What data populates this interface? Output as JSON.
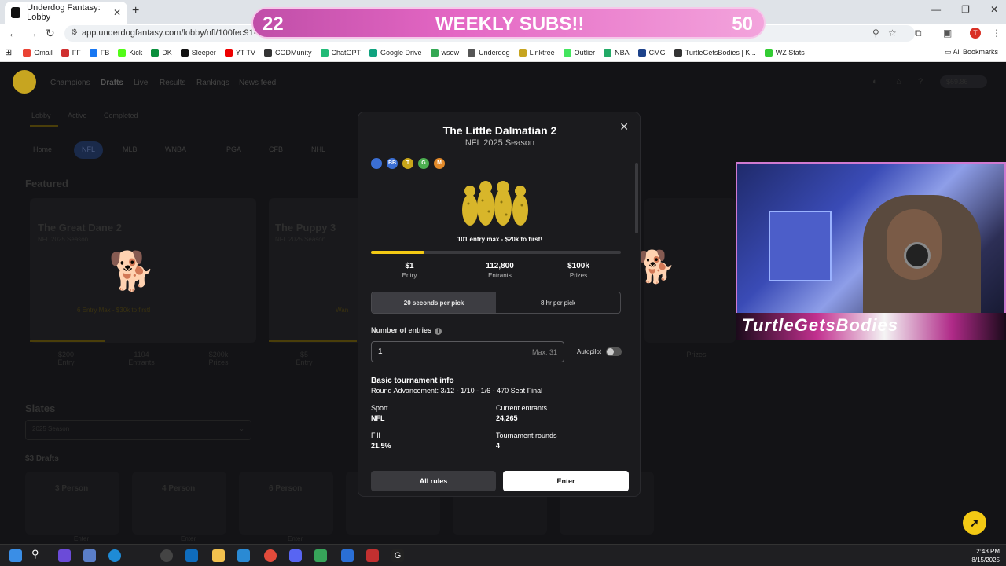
{
  "browser": {
    "tab_title": "Underdog Fantasy: Lobby",
    "url": "app.underdogfantasy.com/lobby/nfl/100fec91-ff4f-43"
  },
  "bookmarks": [
    "Gmail",
    "FF",
    "FB",
    "Kick",
    "DK",
    "Sleeper",
    "YT TV",
    "CODMunity",
    "ChatGPT",
    "Google Drive",
    "wsow",
    "Underdog",
    "Linktree",
    "Outlier",
    "NBA",
    "CMG",
    "TurtleGetsBodies | K...",
    "WZ Stats"
  ],
  "all_bookmarks": "All Bookmarks",
  "page": {
    "nav": [
      "Champions",
      "Drafts",
      "Live",
      "Results",
      "Rankings",
      "News feed"
    ],
    "balance": "$69.86",
    "subnav": [
      "Lobby",
      "Active",
      "Completed"
    ],
    "sports": [
      "Home",
      "NFL",
      "MLB",
      "WNBA",
      "PGA",
      "CFB",
      "NHL"
    ],
    "featured_label": "Featured",
    "cards": [
      {
        "title": "The Great Dane 2",
        "season": "NFL 2025 Season",
        "tag": "6 Entry Max - $30k to first!",
        "stats": [
          "$200",
          "1104",
          "$200k"
        ]
      },
      {
        "title": "The Puppy 3",
        "season": "NFL 2025 Season",
        "tag": "Wan",
        "stats": [
          "$5",
          "",
          ""
        ]
      }
    ],
    "stat_keys": [
      "Entry",
      "Entrants",
      "Prizes"
    ],
    "slates_label": "Slates",
    "slate_select": "2025 Season",
    "drafts_label": "$3 Drafts",
    "smalls": [
      "3 Person",
      "4 Person",
      "6 Person"
    ],
    "enter": "Enter"
  },
  "overlay": {
    "subs_left": "22",
    "subs_label": "WEEKLY SUBS!!",
    "subs_right": "50",
    "cam_name": "TurtleGetsBodies"
  },
  "modal": {
    "title": "The Little Dalmatian 2",
    "subtitle": "NFL 2025 Season",
    "badges": [
      {
        "label": "",
        "color": "#3b6fd4"
      },
      {
        "label": "BB",
        "color": "#3b6fd4"
      },
      {
        "label": "T",
        "color": "#c9a61a"
      },
      {
        "label": "G",
        "color": "#4caf50"
      },
      {
        "label": "M",
        "color": "#e38a2a"
      }
    ],
    "tagline": "101 entry max - $20k to first!",
    "fill_fraction": 0.215,
    "stats": [
      {
        "value": "$1",
        "label": "Entry"
      },
      {
        "value": "112,800",
        "label": "Entrants"
      },
      {
        "value": "$100k",
        "label": "Prizes"
      }
    ],
    "speed_options": [
      "20 seconds per pick",
      "8 hr per pick"
    ],
    "entries_label": "Number of entries",
    "entries_value": "1",
    "entries_max": "Max: 31",
    "autopilot": "Autopilot",
    "info_title": "Basic tournament info",
    "round_advancement": "Round Advancement: 3/12 - 1/10 - 1/6 - 470 Seat Final",
    "info": [
      {
        "key": "Sport",
        "value": "NFL"
      },
      {
        "key": "Current entrants",
        "value": "24,265"
      },
      {
        "key": "Fill",
        "value": "21.5%"
      },
      {
        "key": "Tournament rounds",
        "value": "4"
      }
    ],
    "btn_rules": "All rules",
    "btn_enter": "Enter"
  },
  "taskbar": {
    "time": "2:43 PM",
    "date": "8/15/2025"
  }
}
